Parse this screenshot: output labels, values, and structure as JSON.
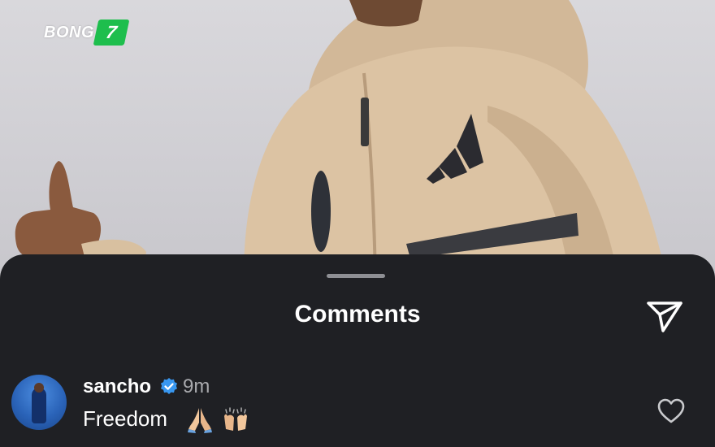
{
  "photo": {
    "logo_text": "BONG",
    "logo_badge": "7"
  },
  "sheet": {
    "title": "Comments"
  },
  "comment": {
    "username": "sancho",
    "time": "9m",
    "text": "Freedom",
    "emojis": [
      "folded-hands-emoji",
      "raising-hands-emoji"
    ]
  },
  "colors": {
    "sheet_bg": "#1f2024",
    "verified_blue": "#3897f0",
    "logo_green": "#1ebe4d"
  }
}
